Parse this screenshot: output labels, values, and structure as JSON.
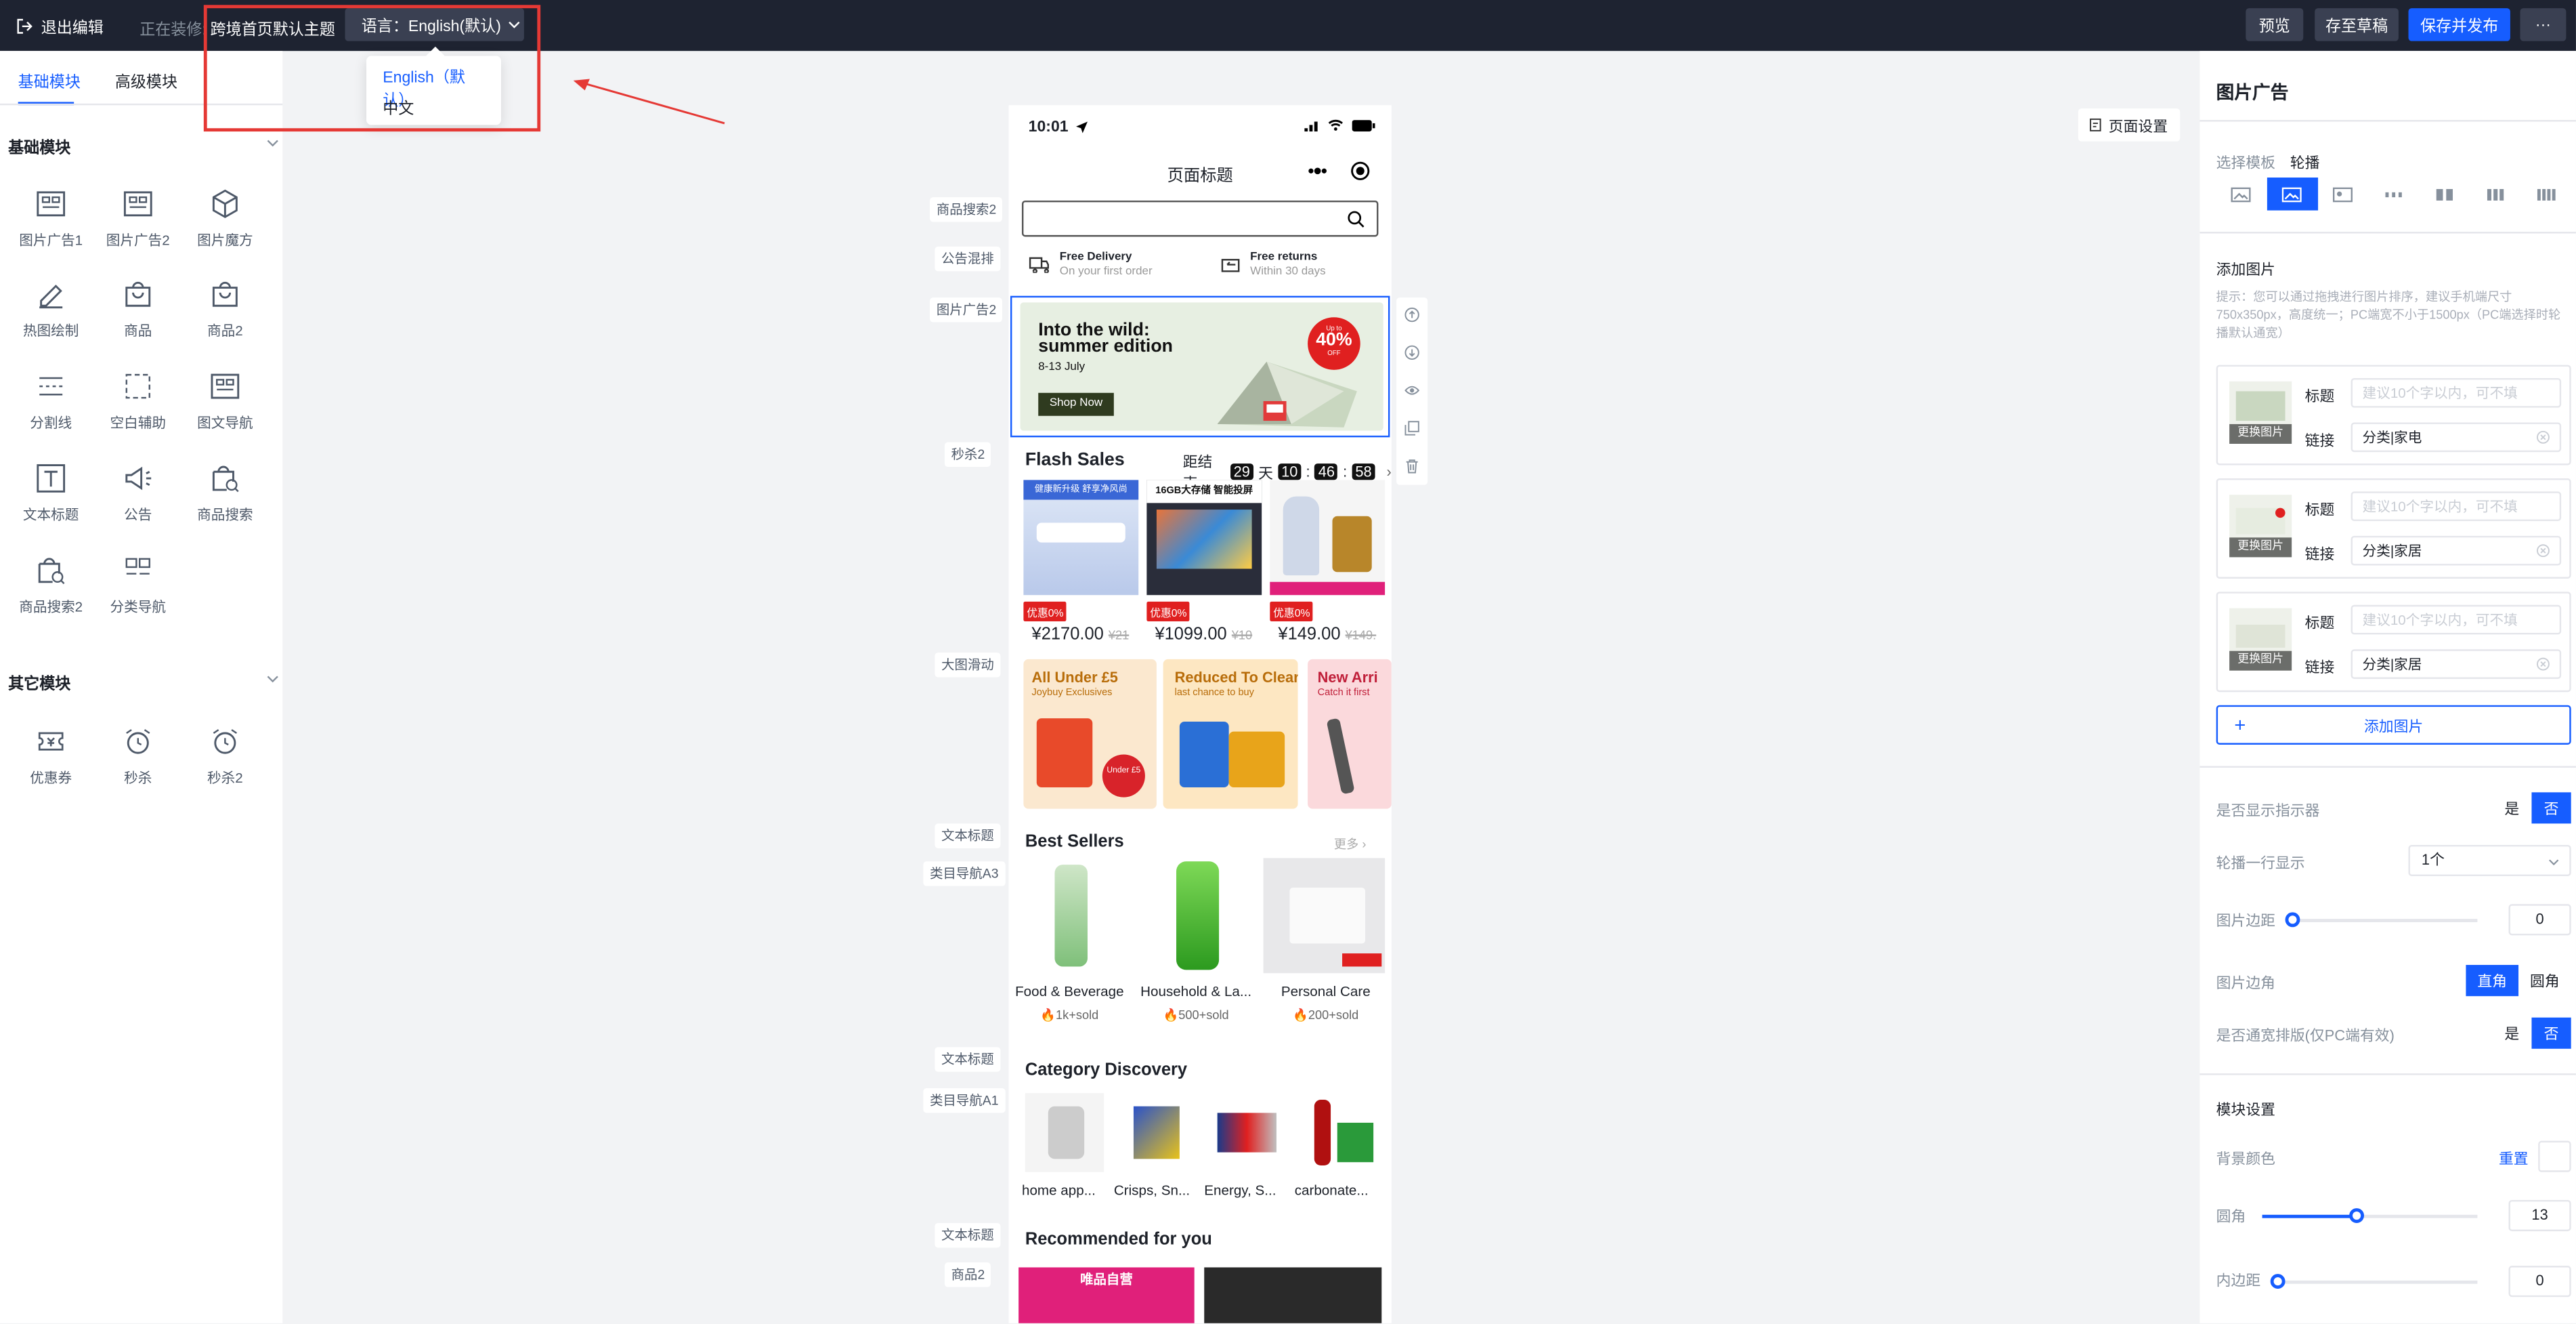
{
  "topbar": {
    "exit_label": "退出编辑",
    "editing_label": "正在装修:",
    "theme_name": "跨境首页默认主题",
    "language_button": "语言：English(默认)",
    "preview_label": "预览",
    "save_draft_label": "存至草稿",
    "save_publish_label": "保存并发布",
    "more_label": "···"
  },
  "language_dropdown": {
    "options": [
      "English（默认）",
      "中文"
    ]
  },
  "left_panel": {
    "tabs": [
      "基础模块",
      "高级模块"
    ],
    "basic_section_title": "基础模块",
    "basic_modules": [
      "图片广告1",
      "图片广告2",
      "图片魔方",
      "热图绘制",
      "商品",
      "商品2",
      "分割线",
      "空白辅助",
      "图文导航",
      "文本标题",
      "公告",
      "商品搜索",
      "商品搜索2",
      "分类导航"
    ],
    "other_section_title": "其它模块",
    "other_modules": [
      "优惠券",
      "秒杀",
      "秒杀2"
    ]
  },
  "canvas_labels": [
    "商品搜索2",
    "公告混排",
    "图片广告2",
    "秒杀2",
    "大图滑动",
    "文本标题",
    "类目导航A3",
    "文本标题",
    "类目导航A1",
    "文本标题",
    "商品2"
  ],
  "page_settings_label": "页面设置",
  "phone": {
    "time": "10:01",
    "page_title": "页面标题",
    "notices": [
      {
        "title": "Free Delivery",
        "sub": "On your first order"
      },
      {
        "title": "Free returns",
        "sub": "Within 30 days"
      }
    ],
    "banner": {
      "headline": "Into the wild: summer edition",
      "date": "8-13 July",
      "cta": "Shop Now",
      "badge_top": "Up to",
      "badge_value": "40%",
      "badge_bottom": "OFF"
    },
    "flash": {
      "title": "Flash Sales",
      "countdown_label": "距结束",
      "days": "29",
      "days_unit": "天",
      "hours": "10",
      "minutes": "46",
      "seconds": "58",
      "products": [
        {
          "tag": "优惠0%",
          "price": "¥2170.00",
          "old": "¥21",
          "img_text": "健康新升级 舒享净风尚"
        },
        {
          "tag": "优惠0%",
          "price": "¥1099.00",
          "old": "¥10",
          "img_text": "16GB大存储 智能投屏"
        },
        {
          "tag": "优惠0%",
          "price": "¥149.00",
          "old": "¥149."
        }
      ]
    },
    "slides": [
      {
        "title": "All Under £5",
        "sub": "Joybuy Exclusives",
        "badge": "Under £5"
      },
      {
        "title": "Reduced To Clear",
        "sub": "last chance to buy"
      },
      {
        "title": "New Arri",
        "sub": "Catch it first"
      }
    ],
    "best_sellers": {
      "title": "Best Sellers",
      "more": "更多",
      "items": [
        {
          "name": "Food & Beverage",
          "sold": "1k+sold"
        },
        {
          "name": "Household & La...",
          "sold": "500+sold"
        },
        {
          "name": "Personal Care",
          "sold": "200+sold"
        }
      ]
    },
    "category_discovery": {
      "title": "Category Discovery",
      "items": [
        "home app...",
        "Crisps, Sn...",
        "Energy, S...",
        "carbonate..."
      ]
    },
    "recommended": {
      "title": "Recommended for you",
      "img_text": "唯品自营"
    }
  },
  "right_panel": {
    "title": "图片广告",
    "template_label": "选择模板",
    "template_value": "轮播",
    "add_image_title": "添加图片",
    "hint": "提示：您可以通过拖拽进行图片排序，建议手机端尺寸750x350px，高度统一；PC端宽不小于1500px（PC端选择时轮播默认通宽）",
    "replace_label": "更换图片",
    "title_label": "标题",
    "link_label": "链接",
    "title_placeholder": "建议10个字以内，可不填",
    "images": [
      {
        "link": "分类|家电"
      },
      {
        "link": "分类|家居"
      },
      {
        "link": "分类|家居"
      }
    ],
    "add_image_button": "添加图片",
    "show_indicator_label": "是否显示指示器",
    "yes": "是",
    "no": "否",
    "per_row_label": "轮播一行显示",
    "per_row_value": "1个",
    "margin_label": "图片边距",
    "margin_value": "0",
    "corner_label": "图片边角",
    "corner_options": [
      "直角",
      "圆角"
    ],
    "fullwidth_label": "是否通宽排版(仅PC端有效)",
    "module_settings_title": "模块设置",
    "bg_color_label": "背景颜色",
    "reset_label": "重置",
    "radius_label": "圆角",
    "radius_value": "13",
    "padding_label": "内边距",
    "padding_value": "0"
  },
  "colors": {
    "accent": "#165dff",
    "topbar": "#1e2331",
    "annotation_red": "#e53935"
  }
}
